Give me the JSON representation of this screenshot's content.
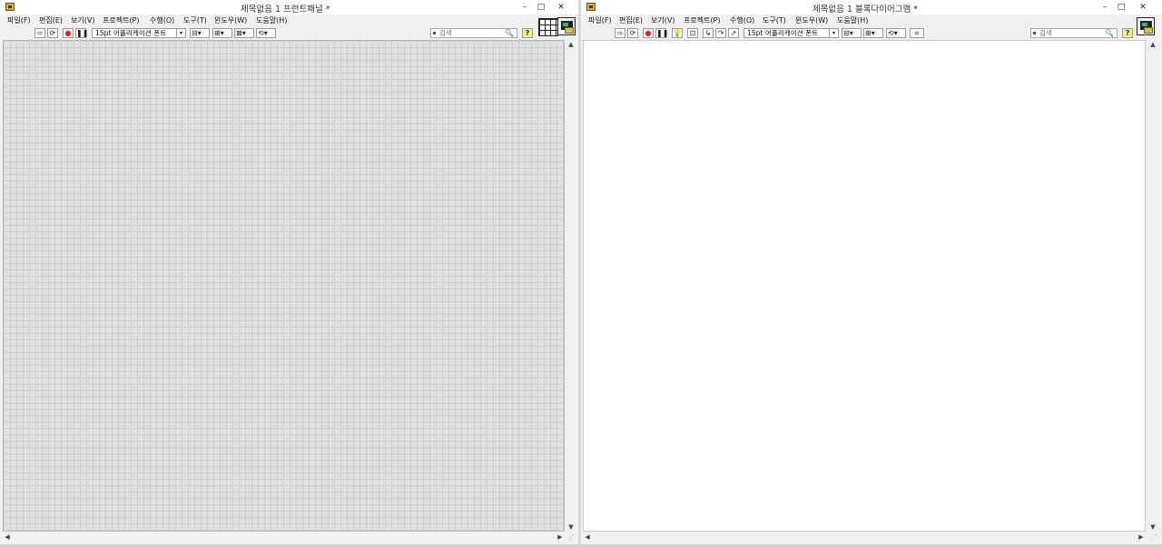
{
  "front_panel": {
    "title": "제목없음 1 프런트패널 *",
    "menus": [
      "파일(F)",
      "편집(E)",
      "보기(V)",
      "프로젝트(P)",
      "수행(O)",
      "도구(T)",
      "윈도우(W)",
      "도움말(H)"
    ],
    "font_select": "15pt 어플리케이션 폰트",
    "search_placeholder": "검색",
    "help_label": "?",
    "window_controls": {
      "minimize": "–",
      "maximize": "□",
      "close": "✕"
    },
    "canvas_color": "#e1e1e1",
    "grid_color": "#cfcfcf"
  },
  "block_diagram": {
    "title": "제목없음 1 블록다이어그램 *",
    "menus": [
      "파일(F)",
      "편집(E)",
      "보기(V)",
      "프로젝트(P)",
      "수행(O)",
      "도구(T)",
      "윈도우(W)",
      "도움말(H)"
    ],
    "font_select": "15pt 어플리케이션 폰트",
    "search_placeholder": "검색",
    "help_label": "?",
    "window_controls": {
      "minimize": "–",
      "maximize": "□",
      "close": "✕"
    },
    "canvas_color": "#ffffff"
  },
  "icons": {
    "run": "⇨",
    "run_continuous": "⟳",
    "abort": "●",
    "pause": "❚❚",
    "highlight_execution": "💡",
    "retain_wire_values": "⊡",
    "step_into": "↳",
    "step_over": "↷",
    "step_out": "↗",
    "align": "⊟",
    "distribute": "⊞",
    "resize": "⊠",
    "reorder": "⟲",
    "cleanup": "⌗",
    "search": "🔍",
    "dropdown": "▾",
    "scroll_up": "▲",
    "scroll_down": "▼",
    "scroll_left": "◀",
    "scroll_right": "▶",
    "grip": "⋰"
  }
}
